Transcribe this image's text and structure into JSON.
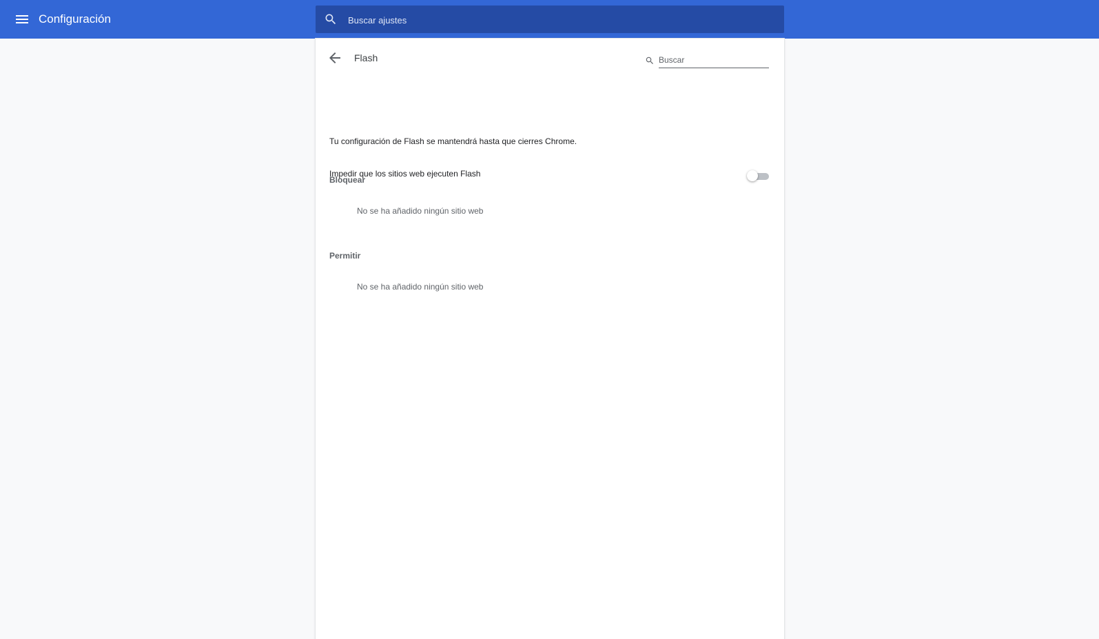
{
  "header": {
    "title": "Configuración",
    "search_placeholder": "Buscar ajustes"
  },
  "subpage": {
    "title": "Flash",
    "search_placeholder": "Buscar",
    "info": "Tu configuración de Flash se mantendrá hasta que cierres Chrome.",
    "toggle_label": "Impedir que los sitios web ejecuten Flash",
    "toggle_on": false
  },
  "sections": {
    "block": {
      "header": "Bloquear",
      "empty": "No se ha añadido ningún sitio web"
    },
    "allow": {
      "header": "Permitir",
      "empty": "No se ha añadido ningún sitio web"
    }
  },
  "colors": {
    "accent": "#3367d6",
    "search_bg": "#254ba5",
    "page_bg": "#f8f9fa"
  },
  "icons": {
    "menu": "menu-icon",
    "search": "search-icon",
    "back": "arrow-back-icon"
  }
}
